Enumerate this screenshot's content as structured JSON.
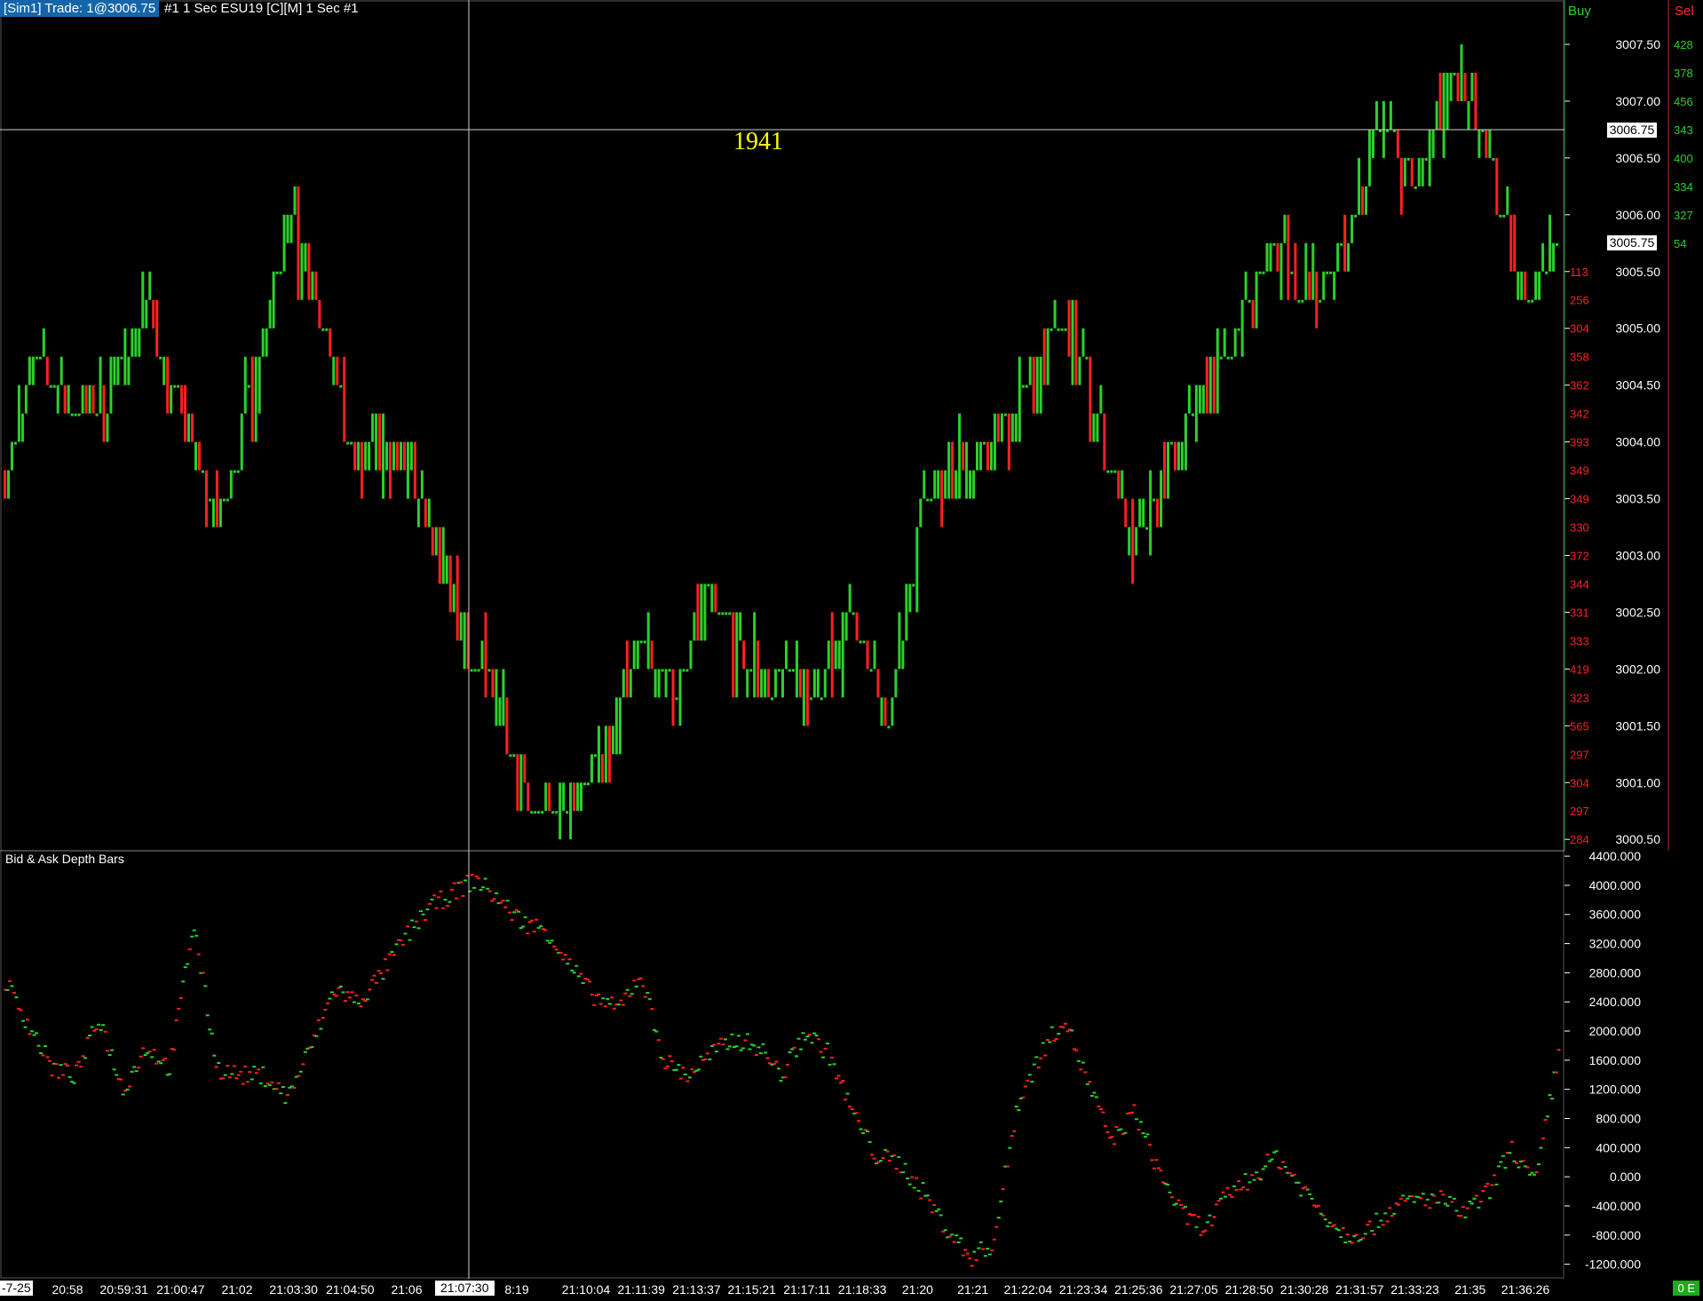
{
  "header": {
    "account_label": "[Sim1]  Trade: 1@3006.75",
    "info": "#1 1 Sec  ESU19 [C][M]  1 Sec   #1"
  },
  "crosshair_value": "1941",
  "crosshair_price_label": "3006.75",
  "last_price_label": "3005.75",
  "crosshair_time_label": "21:07:30",
  "left_time_label": "-7-25",
  "status_label": "0 E",
  "ladder": {
    "buy_label": "Buy",
    "sell_label": "Sel",
    "buy_volumes": [
      {
        "price": 3007.5,
        "vol": "428"
      },
      {
        "price": 3007.25,
        "vol": "378"
      },
      {
        "price": 3007.0,
        "vol": "456"
      },
      {
        "price": 3006.75,
        "vol": "343"
      },
      {
        "price": 3006.5,
        "vol": "400"
      },
      {
        "price": 3006.25,
        "vol": "334"
      },
      {
        "price": 3006.0,
        "vol": "327"
      },
      {
        "price": 3005.75,
        "vol": "54"
      }
    ],
    "sell_volumes": [
      {
        "price": 3005.5,
        "vol": "113"
      },
      {
        "price": 3005.25,
        "vol": "256"
      },
      {
        "price": 3005.0,
        "vol": "304"
      },
      {
        "price": 3004.75,
        "vol": "358"
      },
      {
        "price": 3004.5,
        "vol": "362"
      },
      {
        "price": 3004.25,
        "vol": "342"
      },
      {
        "price": 3004.0,
        "vol": "393"
      },
      {
        "price": 3003.75,
        "vol": "349"
      },
      {
        "price": 3003.5,
        "vol": "349"
      },
      {
        "price": 3003.25,
        "vol": "330"
      },
      {
        "price": 3003.0,
        "vol": "372"
      },
      {
        "price": 3002.75,
        "vol": "344"
      },
      {
        "price": 3002.5,
        "vol": "331"
      },
      {
        "price": 3002.25,
        "vol": "333"
      },
      {
        "price": 3002.0,
        "vol": "419"
      },
      {
        "price": 3001.75,
        "vol": "323"
      },
      {
        "price": 3001.5,
        "vol": "565"
      },
      {
        "price": 3001.25,
        "vol": "297"
      },
      {
        "price": 3001.0,
        "vol": "304"
      },
      {
        "price": 3000.75,
        "vol": "297"
      },
      {
        "price": 3000.5,
        "vol": "284"
      }
    ]
  },
  "indicator_title": "Bid & Ask Depth Bars",
  "colors": {
    "up": "#2bd12b",
    "down": "#ff2020",
    "axis": "#ffffff",
    "crosshair": "#cfcfcf",
    "highlight": "#ffff00"
  },
  "chart_data": [
    {
      "type": "line",
      "title": "",
      "subtitle": "ESU19 1 Sec",
      "y_ticks": [
        "3007.50",
        "3007.00",
        "3006.50",
        "3006.00",
        "3005.50",
        "3005.00",
        "3004.50",
        "3004.00",
        "3003.50",
        "3003.00",
        "3002.50",
        "3002.00",
        "3001.50",
        "3001.00",
        "3000.50"
      ],
      "ylim": [
        3000.4,
        3007.75
      ],
      "x": [
        "20:58",
        "20:59:31",
        "21:00:47",
        "21:02",
        "21:03:30",
        "21:04:50",
        "21:06",
        "21:07:30",
        "21:08:19",
        "21:10:04",
        "21:11:39",
        "21:13:37",
        "21:15:21",
        "21:17:11",
        "21:18:33",
        "21:20",
        "21:21",
        "21:22:04",
        "21:23:34",
        "21:25:36",
        "21:27:05",
        "21:28:50",
        "21:30:28",
        "21:31:57",
        "21:33:23",
        "21:35",
        "21:36:26"
      ],
      "x_tick_labels": [
        "20:58",
        "20:59:31",
        "21:00:47",
        "21:02",
        "21:03:30",
        "21:04:50",
        "21:06",
        "8:19",
        "21:10:04",
        "21:11:39",
        "21:13:37",
        "21:15:21",
        "21:17:11",
        "21:18:33",
        "21:20",
        "21:21",
        "21:22:04",
        "21:23:34",
        "21:25:36",
        "21:27:05",
        "21:28:50",
        "21:30:28",
        "21:31:57",
        "21:33:23",
        "21:35",
        "21:36:26"
      ],
      "series": [
        {
          "values": [
            3003.75,
            3004.75,
            3004.25,
            3004.5,
            3005.25,
            3004.25,
            3003.25,
            3004.5,
            3006.0,
            3005.0,
            3003.75,
            3004.0,
            3003.25,
            3002.25,
            3001.75,
            3000.75,
            3000.75,
            3001.25,
            3002.25,
            3001.75,
            3002.75,
            3002.0,
            3002.0,
            3001.75,
            3002.5,
            3001.5,
            3003.5,
            3003.75,
            3004.0,
            3004.5,
            3005.0,
            3004.25,
            3003.0,
            3003.75,
            3004.5,
            3005.0,
            3005.75,
            3005.25,
            3005.75,
            3006.75,
            3006.25,
            3007.25,
            3006.5,
            3005.25,
            3005.75
          ]
        }
      ]
    },
    {
      "type": "scatter",
      "title": "Bid & Ask Depth Bars",
      "y_ticks": [
        "4400.000",
        "4000.000",
        "3600.000",
        "3200.000",
        "2800.000",
        "2400.000",
        "2000.000",
        "1600.000",
        "1200.000",
        "800.000",
        "400.000",
        "0.000",
        "-400.000",
        "-800.000",
        "-1200.000"
      ],
      "ylim": [
        -1400,
        4450
      ],
      "series": [
        {
          "name": "",
          "values": [
            2700,
            2100,
            1500,
            1400,
            2200,
            1200,
            1800,
            1500,
            3500,
            1500,
            1400,
            1400,
            1100,
            1800,
            2600,
            2400,
            2800,
            3300,
            3700,
            3900,
            4100,
            3800,
            3500,
            3400,
            2900,
            2500,
            2300,
            2800,
            1600,
            1400,
            1700,
            1900,
            1800,
            1400,
            2000,
            1700,
            900,
            300,
            200,
            -200,
            -700,
            -1100,
            -900,
            1000,
            1700,
            2200,
            1300,
            500,
            900,
            100,
            -500,
            -700,
            -200,
            0,
            300,
            -100,
            -500,
            -800,
            -700,
            -400,
            -300,
            -300,
            -500,
            -200,
            400,
            -100,
            1700
          ]
        }
      ]
    }
  ]
}
